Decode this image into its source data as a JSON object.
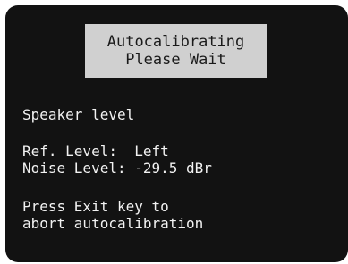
{
  "banner": {
    "line1": "Autocalibrating",
    "line2": "Please Wait"
  },
  "status": {
    "heading": "Speaker level",
    "ref_level": "Ref. Level:  Left",
    "noise_level": "Noise Level: -29.5 dBr"
  },
  "instructions": {
    "line1": "Press Exit key to",
    "line2": "abort autocalibration"
  },
  "colors": {
    "screen_background": "#121212",
    "banner_background": "#d0d0d0",
    "text": "#f2f2f2"
  }
}
